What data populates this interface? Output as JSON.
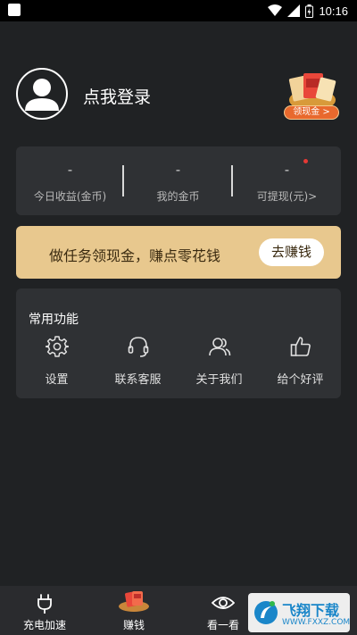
{
  "status_bar": {
    "time": "10:16",
    "icons": [
      "wifi-icon",
      "signal-icon",
      "battery-icon"
    ]
  },
  "profile": {
    "login_text": "点我登录",
    "badge_label": "领现金 >"
  },
  "stats": [
    {
      "value": "-",
      "label": "今日收益(金币)"
    },
    {
      "value": "-",
      "label": "我的金币"
    },
    {
      "value": "-",
      "label": "可提现(元)>"
    }
  ],
  "task_banner": {
    "text": "做任务领现金，赚点零花钱",
    "button": "去赚钱"
  },
  "common": {
    "title": "常用功能",
    "items": [
      {
        "icon": "gear-icon",
        "label": "设置"
      },
      {
        "icon": "headset-icon",
        "label": "联系客服"
      },
      {
        "icon": "users-icon",
        "label": "关于我们"
      },
      {
        "icon": "thumbs-up-icon",
        "label": "给个好评"
      }
    ]
  },
  "bottom_nav": [
    {
      "icon": "plug-icon",
      "label": "充电加速"
    },
    {
      "icon": "red-packet-icon",
      "label": "赚钱"
    },
    {
      "icon": "eye-icon",
      "label": "看一看"
    },
    {
      "icon": "more-icon",
      "label": ""
    }
  ],
  "watermark": {
    "text": "飞翔下载",
    "sub": "WWW.FXXZ.COM"
  },
  "colors": {
    "background": "#202224",
    "card": "#2f3134",
    "banner": "#e8c88e",
    "accent": "#e8692d"
  }
}
